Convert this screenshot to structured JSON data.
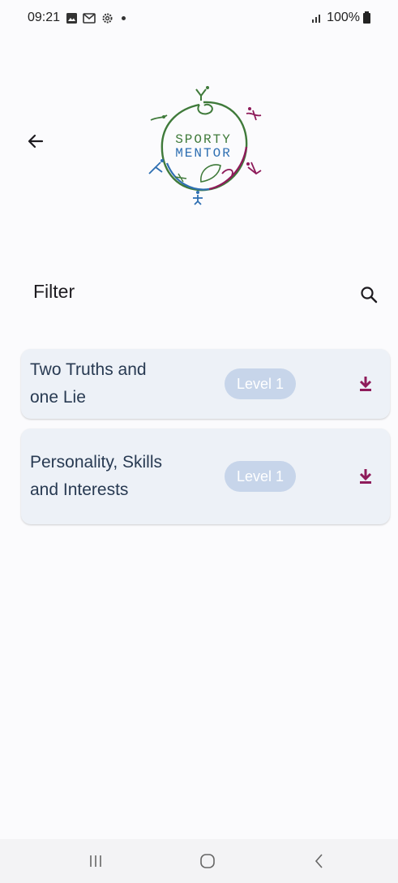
{
  "status_bar": {
    "time": "09:21",
    "signal_icon": "signal-icon",
    "battery": "100%"
  },
  "header": {
    "back_icon": "arrow-back-icon",
    "logo": {
      "line1": "SPORTY",
      "line2": "MENTOR"
    }
  },
  "filter": {
    "label": "Filter",
    "search_icon": "search-icon"
  },
  "activities": [
    {
      "title": "Two Truths and one Lie",
      "level": "Level 1",
      "action_icon": "download-icon"
    },
    {
      "title": "Personality, Skills and Interests",
      "level": "Level 1",
      "action_icon": "download-icon"
    }
  ],
  "colors": {
    "accent": "#8e1b5a",
    "card_bg": "#edf1f7",
    "badge_bg": "#c7d5ea",
    "title_text": "#283a52"
  }
}
